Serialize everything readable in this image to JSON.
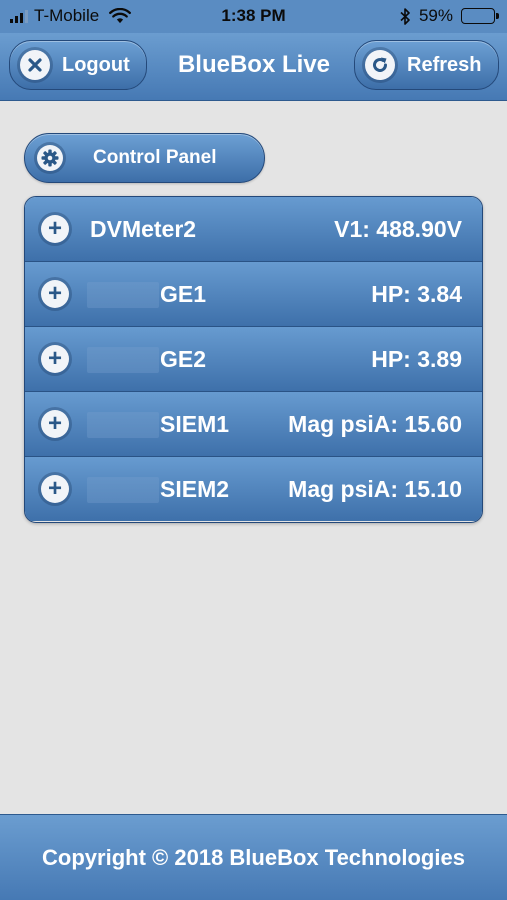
{
  "status_bar": {
    "carrier": "T-Mobile",
    "time": "1:38 PM",
    "battery": "59%",
    "battery_level": 0.59
  },
  "header": {
    "title": "BlueBox Live",
    "logout_label": "Logout",
    "refresh_label": "Refresh"
  },
  "control_panel": {
    "label": "Control Panel"
  },
  "devices": [
    {
      "name": "DVMeter2",
      "value": "V1: 488.90V"
    },
    {
      "name": "GE1",
      "value": "HP: 3.84"
    },
    {
      "name": "GE2",
      "value": "HP: 3.89"
    },
    {
      "name": "SIEM1",
      "value": "Mag psiA: 15.60"
    },
    {
      "name": "SIEM2",
      "value": "Mag psiA: 15.10"
    }
  ],
  "footer": {
    "copyright": "Copyright © 2018 BlueBox Technologies"
  },
  "colors": {
    "accent": "#4679b4",
    "background": "#e4e4e4"
  },
  "icons": {
    "signal": "signal-icon",
    "wifi": "wifi-icon",
    "bluetooth": "bluetooth-icon",
    "battery": "battery-icon",
    "logout": "close-icon",
    "refresh": "refresh-icon",
    "control_panel": "gear-icon",
    "expand": "plus-icon"
  }
}
